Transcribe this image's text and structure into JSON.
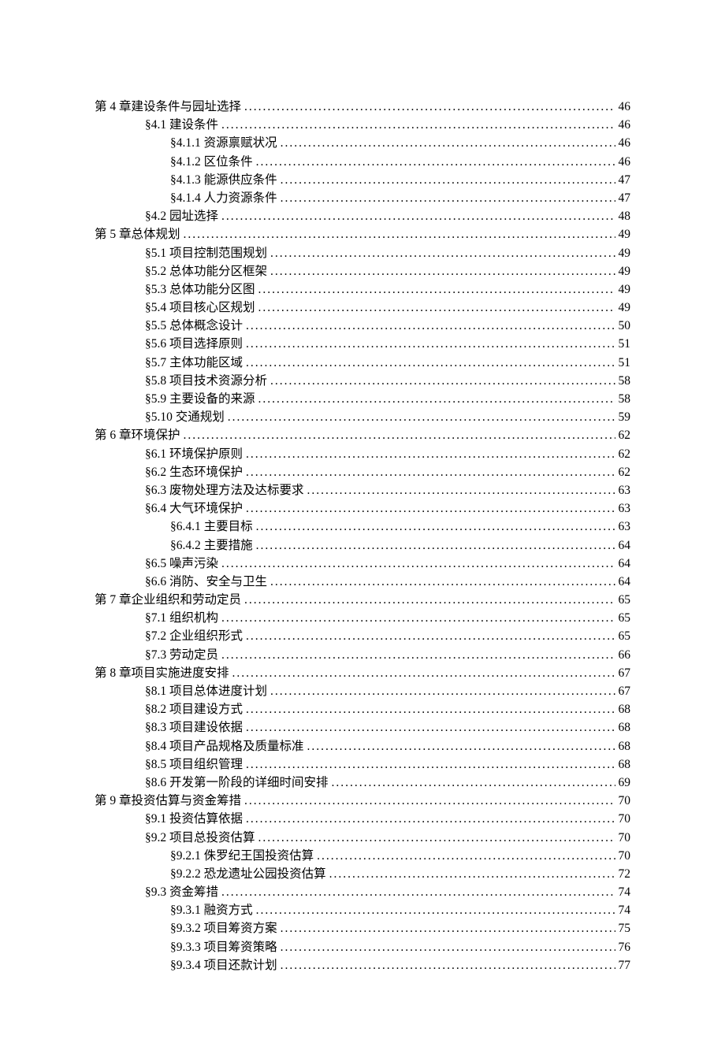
{
  "toc": [
    {
      "level": 1,
      "label": "第 4 章建设条件与园址选择 ",
      "page": " 46"
    },
    {
      "level": 2,
      "label": "§4.1  建设条件",
      "page": " 46"
    },
    {
      "level": 3,
      "label": "§4.1.1  资源禀赋状况 ",
      "page": " 46"
    },
    {
      "level": 3,
      "label": "§4.1.2  区位条件",
      "page": " 46"
    },
    {
      "level": 3,
      "label": "§4.1.3  能源供应条件",
      "page": " 47"
    },
    {
      "level": 3,
      "label": "§4.1.4  人力资源条件",
      "page": " 47"
    },
    {
      "level": 2,
      "label": "§4.2  园址选择 ",
      "page": " 48"
    },
    {
      "level": 1,
      "label": "第 5 章总体规划 ",
      "page": " 49"
    },
    {
      "level": 2,
      "label": "§5.1  项目控制范围规划",
      "page": " 49"
    },
    {
      "level": 2,
      "label": "§5.2  总体功能分区框架 ",
      "page": " 49"
    },
    {
      "level": 2,
      "label": "§5.3  总体功能分区图 ",
      "page": " 49"
    },
    {
      "level": 2,
      "label": "§5.4  项目核心区规划 ",
      "page": " 49"
    },
    {
      "level": 2,
      "label": "§5.5  总体概念设计 ",
      "page": " 50"
    },
    {
      "level": 2,
      "label": "§5.6  项目选择原则 ",
      "page": " 51"
    },
    {
      "level": 2,
      "label": "§5.7  主体功能区域 ",
      "page": " 51"
    },
    {
      "level": 2,
      "label": "§5.8  项目技术资源分析 ",
      "page": " 58"
    },
    {
      "level": 2,
      "label": "§5.9  主要设备的来源 ",
      "page": " 58"
    },
    {
      "level": 2,
      "label": "§5.10  交通规划 ",
      "page": " 59"
    },
    {
      "level": 1,
      "label": "第 6 章环境保护 ",
      "page": " 62"
    },
    {
      "level": 2,
      "label": "§6.1  环境保护原则",
      "page": " 62"
    },
    {
      "level": 2,
      "label": "§6.2  生态环境保护 ",
      "page": " 62"
    },
    {
      "level": 2,
      "label": "§6.3  废物处理方法及达标要求 ",
      "page": " 63"
    },
    {
      "level": 2,
      "label": "§6.4  大气环境保护 ",
      "page": " 63"
    },
    {
      "level": 3,
      "label": "§6.4.1  主要目标 ",
      "page": " 63"
    },
    {
      "level": 3,
      "label": "§6.4.2  主要措施",
      "page": " 64"
    },
    {
      "level": 2,
      "label": "§6.5  噪声污染 ",
      "page": " 64"
    },
    {
      "level": 2,
      "label": "§6.6  消防、安全与卫生 ",
      "page": " 64"
    },
    {
      "level": 1,
      "label": "第 7 章企业组织和劳动定员 ",
      "page": " 65"
    },
    {
      "level": 2,
      "label": "§7.1  组织机构",
      "page": " 65"
    },
    {
      "level": 2,
      "label": "§7.2  企业组织形式 ",
      "page": " 65"
    },
    {
      "level": 2,
      "label": "§7.3  劳动定员 ",
      "page": " 66"
    },
    {
      "level": 1,
      "label": "第 8 章项目实施进度安排 ",
      "page": " 67"
    },
    {
      "level": 2,
      "label": "§8.1  项目总体进度计划",
      "page": " 67"
    },
    {
      "level": 2,
      "label": "§8.2  项目建设方式 ",
      "page": " 68"
    },
    {
      "level": 2,
      "label": "§8.3  项目建设依据 ",
      "page": " 68"
    },
    {
      "level": 2,
      "label": "§8.4  项目产品规格及质量标准 ",
      "page": " 68"
    },
    {
      "level": 2,
      "label": "§8.5  项目组织管理 ",
      "page": " 68"
    },
    {
      "level": 2,
      "label": "§8.6  开发第一阶段的详细时间安排 ",
      "page": " 69"
    },
    {
      "level": 1,
      "label": "第 9 章投资估算与资金筹措 ",
      "page": " 70"
    },
    {
      "level": 2,
      "label": "§9.1  投资估算依据",
      "page": " 70"
    },
    {
      "level": 2,
      "label": "§9.2  项目总投资估算 ",
      "page": " 70"
    },
    {
      "level": 3,
      "label": "§9.2.1  侏罗纪王国投资估算",
      "page": " 70"
    },
    {
      "level": 3,
      "label": "§9.2.2  恐龙遗址公园投资估算",
      "page": " 72"
    },
    {
      "level": 2,
      "label": "§9.3   资金筹措",
      "page": " 74"
    },
    {
      "level": 3,
      "label": "§9.3.1  融资方式",
      "page": " 74"
    },
    {
      "level": 3,
      "label": "§9.3.2  项目筹资方案",
      "page": " 75"
    },
    {
      "level": 3,
      "label": "§9.3.3  项目筹资策略",
      "page": " 76"
    },
    {
      "level": 3,
      "label": "§9.3.4  项目还款计划",
      "page": " 77"
    }
  ]
}
